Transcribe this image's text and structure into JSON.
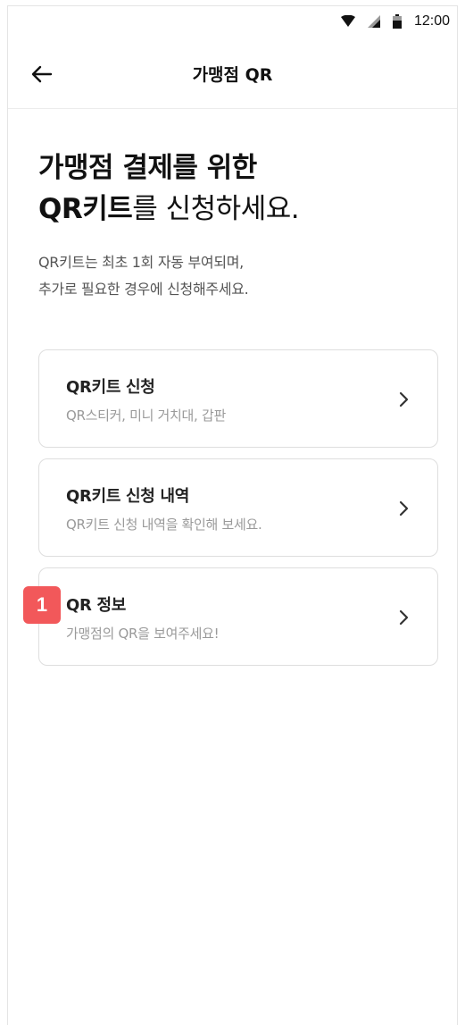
{
  "status_bar": {
    "time": "12:00",
    "icons": [
      "wifi-icon",
      "signal-icon",
      "battery-icon"
    ]
  },
  "app_bar": {
    "back_icon": "arrow-left-icon",
    "title": "가맹점 QR"
  },
  "headline": {
    "line1": "가맹점 결제를 위한",
    "line2_bold": "QR키트",
    "line2_rest": "를 신청하세요."
  },
  "subtext": {
    "line1": "QR키트는 최초 1회 자동 부여되며,",
    "line2": "추가로 필요한 경우에 신청해주세요."
  },
  "menu": {
    "items": [
      {
        "title": "QR키트 신청",
        "description": "QR스티커, 미니 거치대, 갑판"
      },
      {
        "title": "QR키트 신청 내역",
        "description": "QR키트 신청 내역을 확인해 보세요."
      },
      {
        "title": "QR 정보",
        "description": "가맹점의 QR을 보여주세요!",
        "badge": "1"
      }
    ]
  },
  "colors": {
    "badge": "#f2585a",
    "card_border": "#dedede",
    "muted_text": "#9a9a9a"
  }
}
